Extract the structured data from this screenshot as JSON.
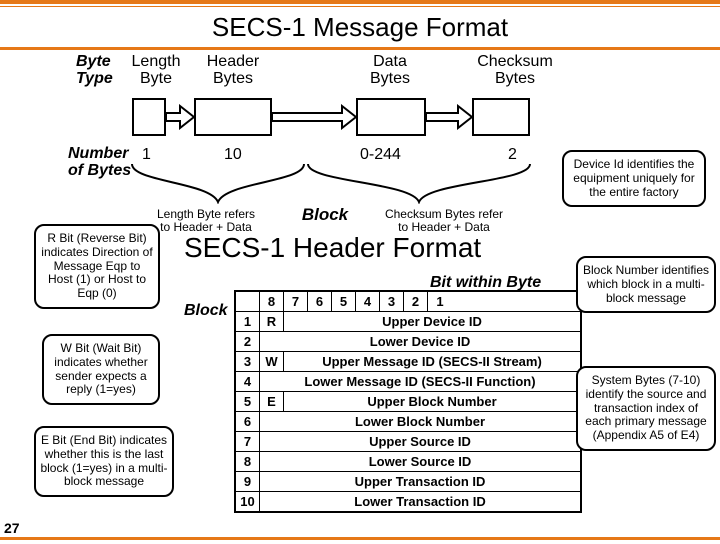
{
  "title": "SECS-1 Message Format",
  "row_byte_type": "Byte\nType",
  "bt": {
    "len": "Length\nByte",
    "hdr": "Header\nBytes",
    "data": "Data\nBytes",
    "chk": "Checksum\nBytes"
  },
  "row_num": "Number\nof Bytes",
  "nums": {
    "n1": "1",
    "n2": "10",
    "n3": "0-244",
    "n4": "2"
  },
  "note_len": "Length Byte refers\nto Header + Data",
  "note_block": "Block",
  "note_chk": "Checksum Bytes refer\nto Header + Data",
  "h2": "SECS-1 Header Format",
  "bitwithin": "Bit within Byte",
  "block_side": "Block",
  "callouts": {
    "r": "R Bit (Reverse Bit) indicates Direction of Message Eqp to Host (1) or Host to Eqp (0)",
    "w": "W  Bit (Wait Bit) indicates whether sender expects a reply (1=yes)",
    "e": "E  Bit (End Bit) indicates whether this is the last block (1=yes) in a multi-block message",
    "dev": "Device Id identifies the equipment uniquely for the entire factory",
    "blk": "Block Number identifies which block in a multi-block message",
    "sys": "System Bytes (7-10) identify the source and transaction index of each primary message (Appendix A5 of E4)"
  },
  "table": {
    "bits": [
      "8",
      "7",
      "6",
      "5",
      "4",
      "3",
      "2",
      "1"
    ],
    "rows": [
      {
        "idx": "1",
        "flag": "R",
        "desc": "Upper Device ID"
      },
      {
        "idx": "2",
        "flag": "",
        "desc": "Lower Device ID"
      },
      {
        "idx": "3",
        "flag": "W",
        "desc": "Upper Message ID (SECS-II Stream)"
      },
      {
        "idx": "4",
        "flag": "",
        "desc": "Lower Message ID (SECS-II Function)"
      },
      {
        "idx": "5",
        "flag": "E",
        "desc": "Upper Block Number"
      },
      {
        "idx": "6",
        "flag": "",
        "desc": "Lower Block Number"
      },
      {
        "idx": "7",
        "flag": "",
        "desc": "Upper Source ID"
      },
      {
        "idx": "8",
        "flag": "",
        "desc": "Lower Source ID"
      },
      {
        "idx": "9",
        "flag": "",
        "desc": "Upper Transaction ID"
      },
      {
        "idx": "10",
        "flag": "",
        "desc": "Lower Transaction ID"
      }
    ]
  },
  "pagenum": "27"
}
